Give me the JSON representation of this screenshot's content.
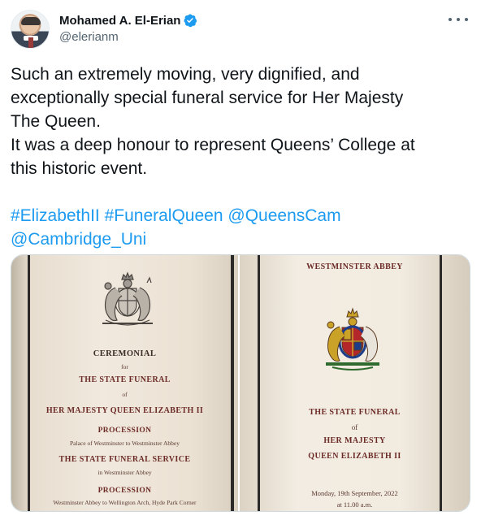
{
  "author": {
    "display_name": "Mohamed A. El-Erian",
    "handle": "@elerianm",
    "verified": true
  },
  "tweet": {
    "lines": [
      "Such an extremely moving, very dignified, and",
      "exceptionally special funeral service for Her Majesty",
      "The Queen.",
      "It was a deep honour to represent Queens’ College at",
      "this historic event."
    ],
    "hashtags_line1": [
      "#ElizabethII",
      "#FuneralQueen",
      "@QueensCam"
    ],
    "hashtags_line2": [
      "@Cambridge_Uni"
    ]
  },
  "media": {
    "left_photo": {
      "ceremonial": "CEREMONIAL",
      "for": "for",
      "state_funeral": "THE STATE FUNERAL",
      "of": "of",
      "queen": "HER MAJESTY QUEEN ELIZABETH II",
      "procession1": "PROCESSION",
      "procession1_route": "Palace of Westminster to Westminster Abbey",
      "service": "THE STATE FUNERAL SERVICE",
      "service_place": "in Westminster Abbey",
      "procession2": "PROCESSION",
      "procession2_route": "Westminster Abbey to Wellington Arch, Hyde Park Corner"
    },
    "right_photo": {
      "header": "WESTMINSTER ABBEY",
      "state_funeral": "THE STATE FUNERAL",
      "of": "of",
      "her_majesty": "HER MAJESTY",
      "queen": "QUEEN ELIZABETH II",
      "date": "Monday, 19th September, 2022",
      "time": "at 11.00 a.m."
    }
  },
  "colors": {
    "link": "#1d9bf0",
    "text": "#0f1419",
    "secondary": "#536471",
    "print_red": "#6b2a26"
  }
}
